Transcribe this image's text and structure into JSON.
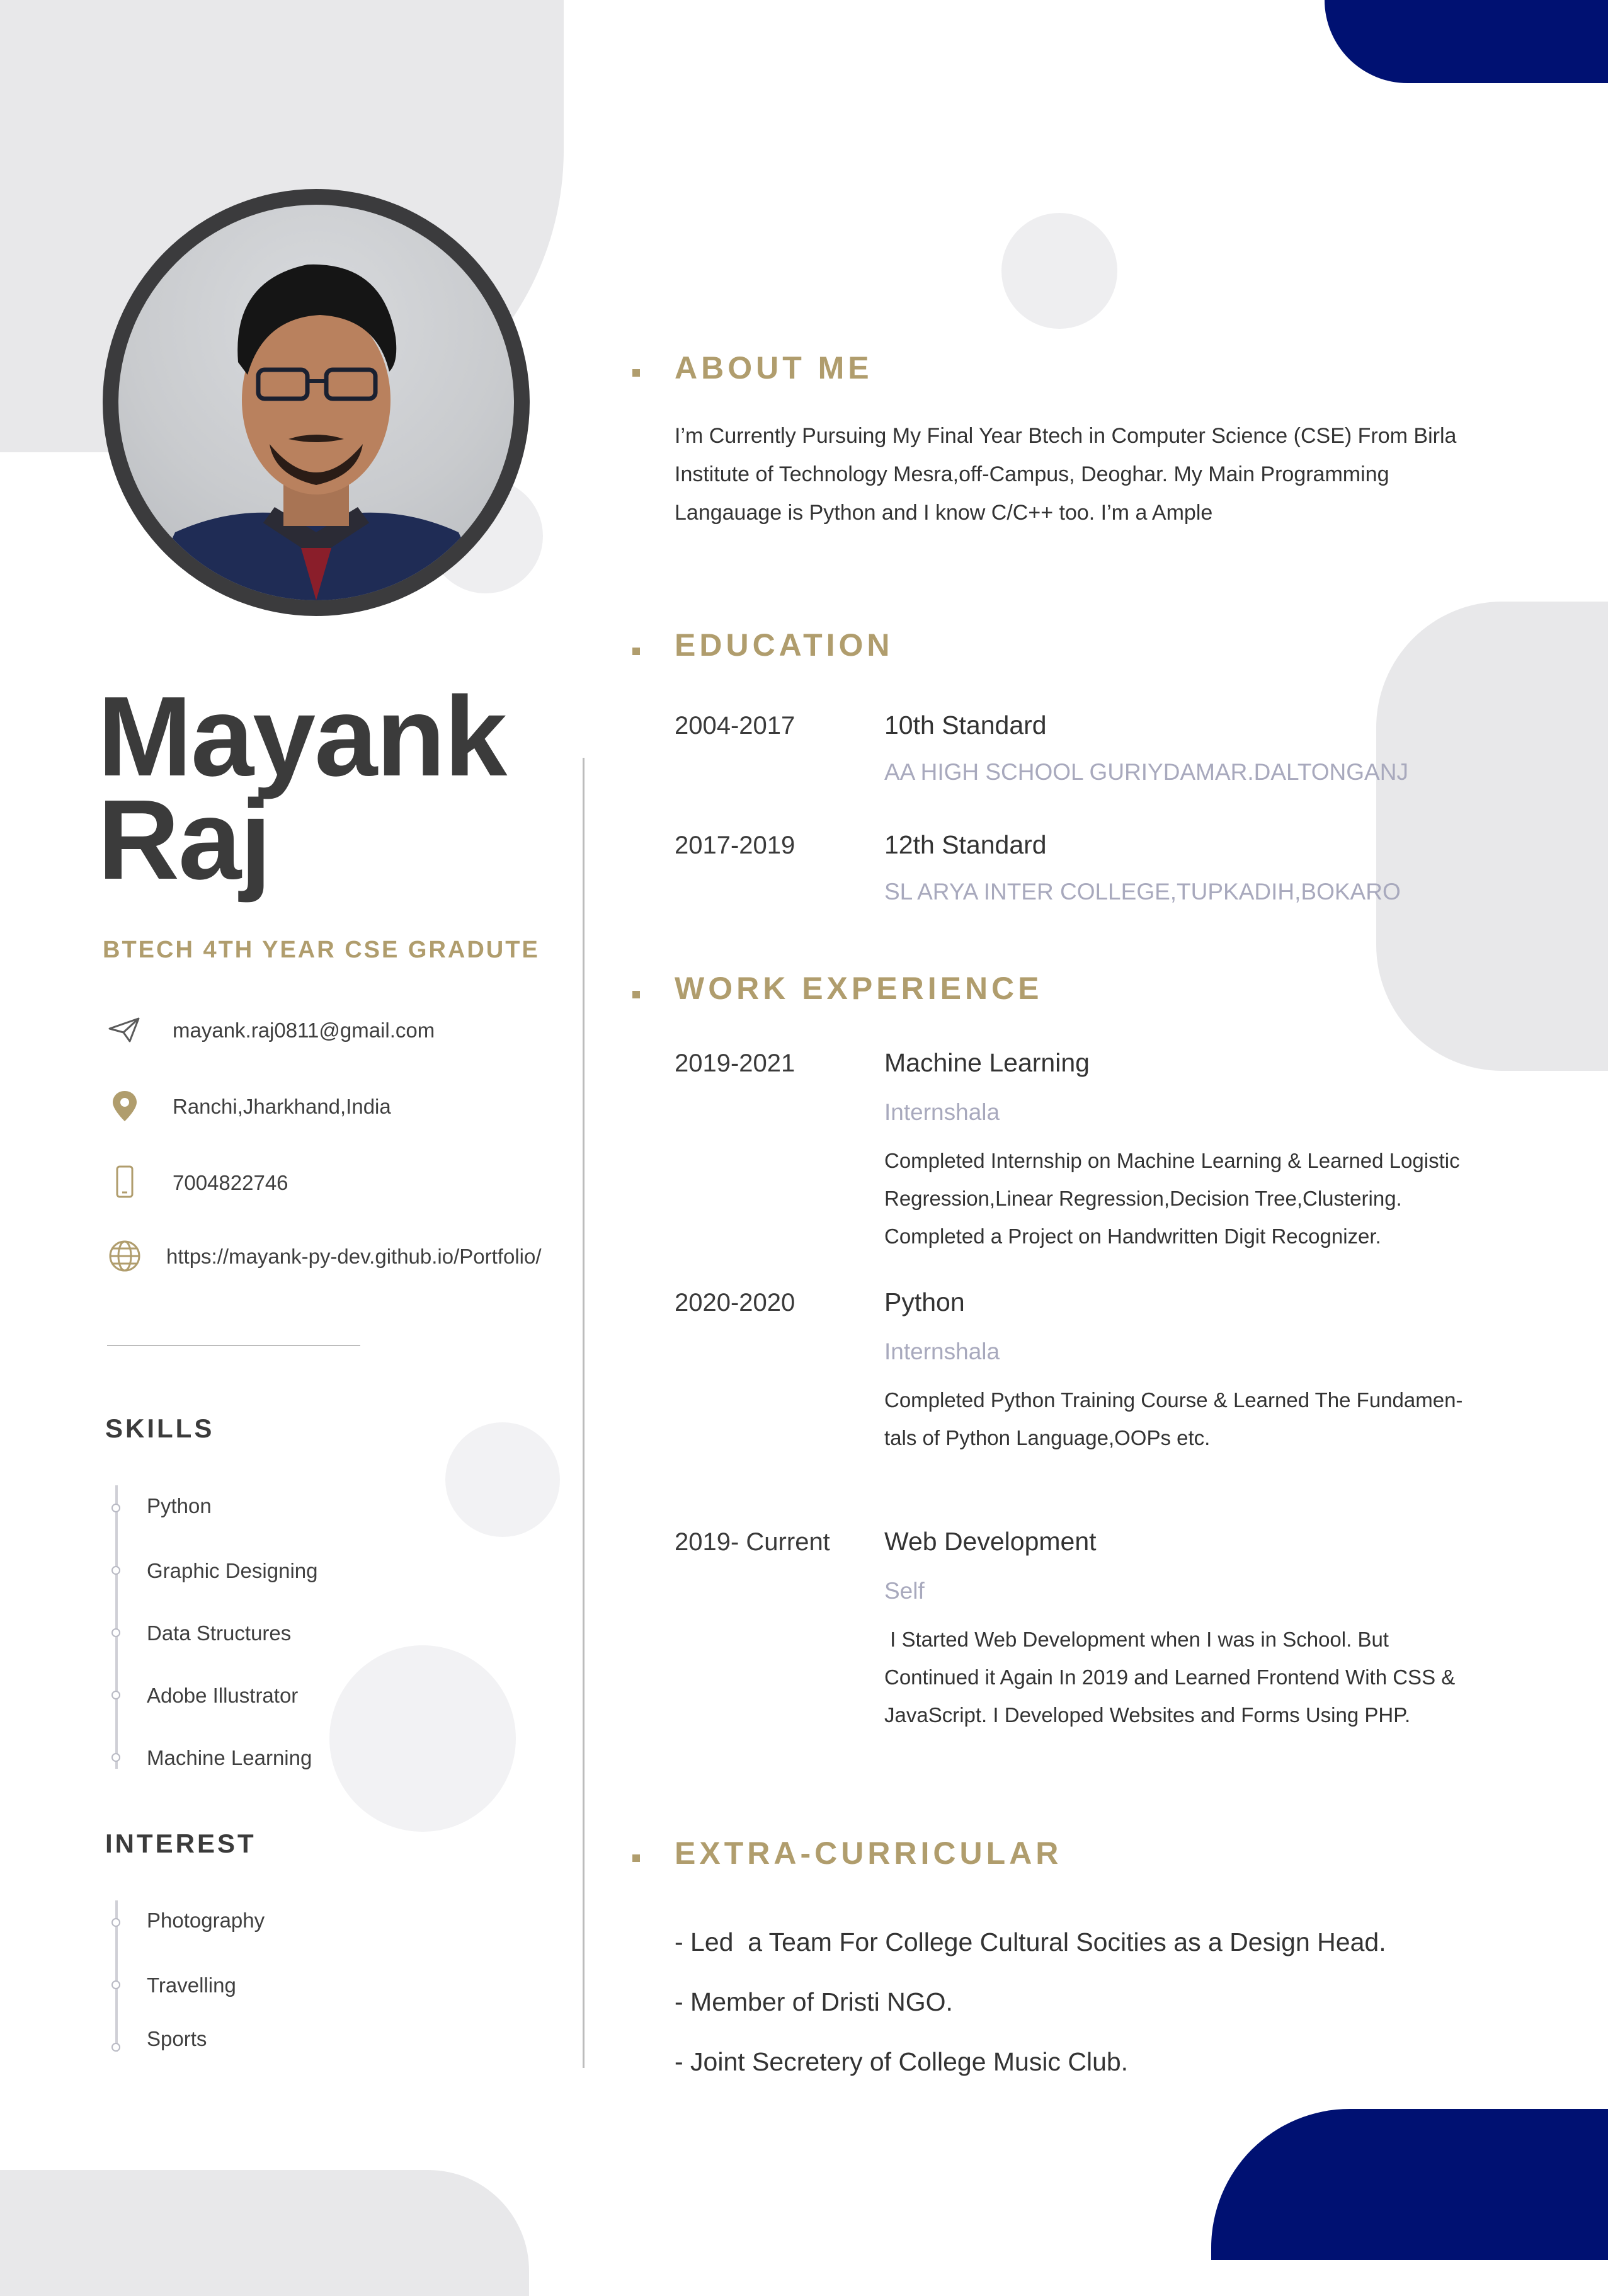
{
  "profile": {
    "name_first": "Mayank",
    "name_last": "Raj",
    "subtitle": "BTECH 4TH YEAR CSE GRADUTE"
  },
  "contact": [
    {
      "icon": "send-icon",
      "text": "mayank.raj0811@gmail.com"
    },
    {
      "icon": "location-pin-icon",
      "text": "Ranchi,Jharkhand,India"
    },
    {
      "icon": "phone-icon",
      "text": "7004822746"
    },
    {
      "icon": "globe-icon",
      "text": "https://mayank-py-dev.github.io/Portfolio/"
    }
  ],
  "skills": {
    "heading": "SKILLS",
    "items": [
      "Python",
      "Graphic Designing",
      "Data Structures",
      "Adobe Illustrator",
      "Machine Learning"
    ]
  },
  "interest": {
    "heading": "INTEREST",
    "items": [
      "Photography",
      "Travelling",
      "Sports"
    ]
  },
  "about": {
    "heading": "ABOUT ME",
    "lines": [
      "I’m Currently Pursuing My Final Year Btech in Computer Science (CSE) From Birla",
      "Institute of Technology Mesra,off-Campus, Deoghar. My Main Programming",
      "Langauage is Python and I know C/C++ too. I’m a Ample"
    ]
  },
  "education": {
    "heading": "EDUCATION",
    "entries": [
      {
        "years": "2004-2017",
        "title": "10th Standard",
        "school": "AA HIGH SCHOOL GURIYDAMAR.DALTONGANJ"
      },
      {
        "years": "2017-2019",
        "title": "12th Standard",
        "school": "SL ARYA INTER COLLEGE,TUPKADIH,BOKARO"
      }
    ]
  },
  "work": {
    "heading": "WORK EXPERIENCE",
    "entries": [
      {
        "years": "2019-2021",
        "title": "Machine Learning",
        "org": "Internshala",
        "lines": [
          "Completed Internship on Machine Learning & Learned Logistic",
          "Regression,Linear Regression,Decision Tree,Clustering.",
          "Completed a Project on Handwritten Digit Recognizer."
        ]
      },
      {
        "years": "2020-2020",
        "title": "Python",
        "org": "Internshala",
        "lines": [
          "Completed Python Training Course & Learned The Fundamen-",
          "tals of Python Language,OOPs etc."
        ]
      },
      {
        "years": "2019- Current",
        "title": "Web Development",
        "org": "Self",
        "lines": [
          " I Started Web Development when I was in School. But",
          "Continued it Again In 2019 and Learned Frontend With CSS &",
          "JavaScript. I Developed Websites and Forms Using PHP."
        ]
      }
    ]
  },
  "extra": {
    "heading": "EXTRA-CURRICULAR",
    "items": [
      "- Led  a Team For College Cultural Socities as a Design Head.",
      "- Member of Dristi NGO.",
      "- Joint Secretery of College Music Club."
    ]
  },
  "colors": {
    "accent_gold": "#b09d6d",
    "accent_blue": "#001172",
    "shape_gray": "#e8e8ea"
  }
}
